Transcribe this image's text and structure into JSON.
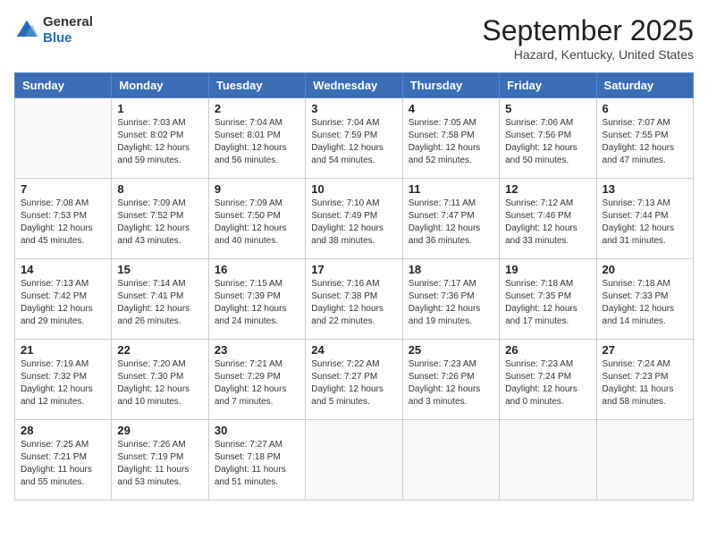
{
  "header": {
    "logo_line1": "General",
    "logo_line2": "Blue",
    "month": "September 2025",
    "location": "Hazard, Kentucky, United States"
  },
  "weekdays": [
    "Sunday",
    "Monday",
    "Tuesday",
    "Wednesday",
    "Thursday",
    "Friday",
    "Saturday"
  ],
  "weeks": [
    [
      {
        "day": "",
        "sunrise": "",
        "sunset": "",
        "daylight": ""
      },
      {
        "day": "1",
        "sunrise": "Sunrise: 7:03 AM",
        "sunset": "Sunset: 8:02 PM",
        "daylight": "Daylight: 12 hours and 59 minutes."
      },
      {
        "day": "2",
        "sunrise": "Sunrise: 7:04 AM",
        "sunset": "Sunset: 8:01 PM",
        "daylight": "Daylight: 12 hours and 56 minutes."
      },
      {
        "day": "3",
        "sunrise": "Sunrise: 7:04 AM",
        "sunset": "Sunset: 7:59 PM",
        "daylight": "Daylight: 12 hours and 54 minutes."
      },
      {
        "day": "4",
        "sunrise": "Sunrise: 7:05 AM",
        "sunset": "Sunset: 7:58 PM",
        "daylight": "Daylight: 12 hours and 52 minutes."
      },
      {
        "day": "5",
        "sunrise": "Sunrise: 7:06 AM",
        "sunset": "Sunset: 7:56 PM",
        "daylight": "Daylight: 12 hours and 50 minutes."
      },
      {
        "day": "6",
        "sunrise": "Sunrise: 7:07 AM",
        "sunset": "Sunset: 7:55 PM",
        "daylight": "Daylight: 12 hours and 47 minutes."
      }
    ],
    [
      {
        "day": "7",
        "sunrise": "Sunrise: 7:08 AM",
        "sunset": "Sunset: 7:53 PM",
        "daylight": "Daylight: 12 hours and 45 minutes."
      },
      {
        "day": "8",
        "sunrise": "Sunrise: 7:09 AM",
        "sunset": "Sunset: 7:52 PM",
        "daylight": "Daylight: 12 hours and 43 minutes."
      },
      {
        "day": "9",
        "sunrise": "Sunrise: 7:09 AM",
        "sunset": "Sunset: 7:50 PM",
        "daylight": "Daylight: 12 hours and 40 minutes."
      },
      {
        "day": "10",
        "sunrise": "Sunrise: 7:10 AM",
        "sunset": "Sunset: 7:49 PM",
        "daylight": "Daylight: 12 hours and 38 minutes."
      },
      {
        "day": "11",
        "sunrise": "Sunrise: 7:11 AM",
        "sunset": "Sunset: 7:47 PM",
        "daylight": "Daylight: 12 hours and 36 minutes."
      },
      {
        "day": "12",
        "sunrise": "Sunrise: 7:12 AM",
        "sunset": "Sunset: 7:46 PM",
        "daylight": "Daylight: 12 hours and 33 minutes."
      },
      {
        "day": "13",
        "sunrise": "Sunrise: 7:13 AM",
        "sunset": "Sunset: 7:44 PM",
        "daylight": "Daylight: 12 hours and 31 minutes."
      }
    ],
    [
      {
        "day": "14",
        "sunrise": "Sunrise: 7:13 AM",
        "sunset": "Sunset: 7:42 PM",
        "daylight": "Daylight: 12 hours and 29 minutes."
      },
      {
        "day": "15",
        "sunrise": "Sunrise: 7:14 AM",
        "sunset": "Sunset: 7:41 PM",
        "daylight": "Daylight: 12 hours and 26 minutes."
      },
      {
        "day": "16",
        "sunrise": "Sunrise: 7:15 AM",
        "sunset": "Sunset: 7:39 PM",
        "daylight": "Daylight: 12 hours and 24 minutes."
      },
      {
        "day": "17",
        "sunrise": "Sunrise: 7:16 AM",
        "sunset": "Sunset: 7:38 PM",
        "daylight": "Daylight: 12 hours and 22 minutes."
      },
      {
        "day": "18",
        "sunrise": "Sunrise: 7:17 AM",
        "sunset": "Sunset: 7:36 PM",
        "daylight": "Daylight: 12 hours and 19 minutes."
      },
      {
        "day": "19",
        "sunrise": "Sunrise: 7:18 AM",
        "sunset": "Sunset: 7:35 PM",
        "daylight": "Daylight: 12 hours and 17 minutes."
      },
      {
        "day": "20",
        "sunrise": "Sunrise: 7:18 AM",
        "sunset": "Sunset: 7:33 PM",
        "daylight": "Daylight: 12 hours and 14 minutes."
      }
    ],
    [
      {
        "day": "21",
        "sunrise": "Sunrise: 7:19 AM",
        "sunset": "Sunset: 7:32 PM",
        "daylight": "Daylight: 12 hours and 12 minutes."
      },
      {
        "day": "22",
        "sunrise": "Sunrise: 7:20 AM",
        "sunset": "Sunset: 7:30 PM",
        "daylight": "Daylight: 12 hours and 10 minutes."
      },
      {
        "day": "23",
        "sunrise": "Sunrise: 7:21 AM",
        "sunset": "Sunset: 7:29 PM",
        "daylight": "Daylight: 12 hours and 7 minutes."
      },
      {
        "day": "24",
        "sunrise": "Sunrise: 7:22 AM",
        "sunset": "Sunset: 7:27 PM",
        "daylight": "Daylight: 12 hours and 5 minutes."
      },
      {
        "day": "25",
        "sunrise": "Sunrise: 7:23 AM",
        "sunset": "Sunset: 7:26 PM",
        "daylight": "Daylight: 12 hours and 3 minutes."
      },
      {
        "day": "26",
        "sunrise": "Sunrise: 7:23 AM",
        "sunset": "Sunset: 7:24 PM",
        "daylight": "Daylight: 12 hours and 0 minutes."
      },
      {
        "day": "27",
        "sunrise": "Sunrise: 7:24 AM",
        "sunset": "Sunset: 7:23 PM",
        "daylight": "Daylight: 11 hours and 58 minutes."
      }
    ],
    [
      {
        "day": "28",
        "sunrise": "Sunrise: 7:25 AM",
        "sunset": "Sunset: 7:21 PM",
        "daylight": "Daylight: 11 hours and 55 minutes."
      },
      {
        "day": "29",
        "sunrise": "Sunrise: 7:26 AM",
        "sunset": "Sunset: 7:19 PM",
        "daylight": "Daylight: 11 hours and 53 minutes."
      },
      {
        "day": "30",
        "sunrise": "Sunrise: 7:27 AM",
        "sunset": "Sunset: 7:18 PM",
        "daylight": "Daylight: 11 hours and 51 minutes."
      },
      {
        "day": "",
        "sunrise": "",
        "sunset": "",
        "daylight": ""
      },
      {
        "day": "",
        "sunrise": "",
        "sunset": "",
        "daylight": ""
      },
      {
        "day": "",
        "sunrise": "",
        "sunset": "",
        "daylight": ""
      },
      {
        "day": "",
        "sunrise": "",
        "sunset": "",
        "daylight": ""
      }
    ]
  ]
}
